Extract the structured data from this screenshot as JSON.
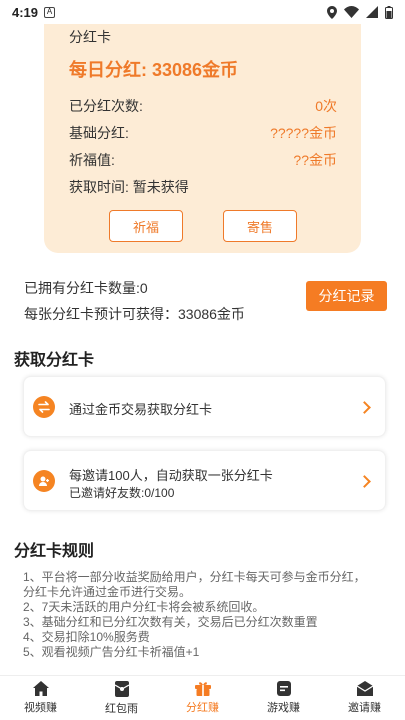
{
  "status": {
    "time": "4:19"
  },
  "card": {
    "title": "分红卡",
    "daily": "每日分红: 33086金币",
    "rows": [
      {
        "label": "已分红次数:",
        "value": "0次"
      },
      {
        "label": "基础分红:",
        "value": "?????金币"
      },
      {
        "label": "祈福值:",
        "value": "??金币"
      }
    ],
    "obtain_time": "获取时间: 暂未获得",
    "bless_button": "祈福",
    "sell_button": "寄售"
  },
  "own": {
    "count": "已拥有分红卡数量:0",
    "expected": "每张分红卡预计可获得：33086金币",
    "record_button": "分红记录"
  },
  "obtain_section": {
    "title": "获取分红卡",
    "tasks": [
      {
        "title": "通过金币交易获取分红卡"
      },
      {
        "title": "每邀请100人，自动获取一张分红卡",
        "sub": "已邀请好友数:0/100"
      }
    ]
  },
  "rules_section": {
    "title": "分红卡规则",
    "lines": [
      "1、平台将一部分收益奖励给用户，分红卡每天可参与金币分红，",
      "分红卡允许通过金币进行交易。",
      "2、7天未活跃的用户分红卡将会被系统回收。",
      "3、基础分红和已分红次数有关，交易后已分红次数重置",
      "4、交易扣除10%服务费",
      "5、观看视频广告分红卡祈福值+1"
    ]
  },
  "tabs": [
    {
      "label": "视频赚",
      "icon": "home-icon"
    },
    {
      "label": "红包雨",
      "icon": "red-packet-icon"
    },
    {
      "label": "分红赚",
      "icon": "gift-icon"
    },
    {
      "label": "游戏赚",
      "icon": "game-icon"
    },
    {
      "label": "邀请赚",
      "icon": "invite-icon"
    }
  ],
  "colors": {
    "accent": "#f57c23",
    "card_bg": "#fdecd6"
  }
}
